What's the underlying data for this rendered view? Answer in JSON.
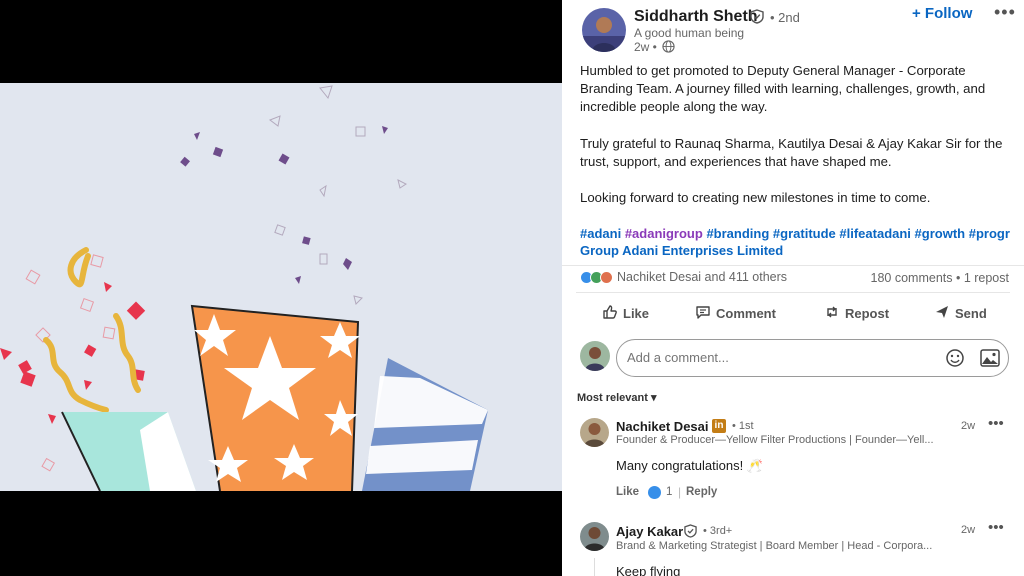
{
  "post": {
    "author": {
      "name": "Siddharth Sheth",
      "degree": "• 2nd",
      "headline": "A good human being",
      "time": "2w •"
    },
    "follow_label": "+ Follow",
    "more_label": "•••",
    "body_paragraphs": [
      "Humbled to get promoted to Deputy General Manager - Corporate Branding Team. A journey filled with learning, challenges, growth, and incredible people along the way.",
      "Truly grateful to Raunaq Sharma, Kautilya Desai & Ajay Kakar Sir for the trust, support, and experiences that have shaped me.",
      "Looking forward to creating new milestones in time to come."
    ],
    "hashtags": {
      "h1": "#adani",
      "h2": "#adanigroup",
      "h3": "#branding",
      "h4": "#gratitude",
      "h5": "#lifeatadani",
      "h6": "#growth",
      "h7": "#progr"
    },
    "group_link": "Group Adani Enterprises Limited",
    "reactions_text": "Nachiket Desai and 411 others",
    "counts_text": "180 comments • 1 repost",
    "actions": {
      "like": "Like",
      "comment": "Comment",
      "repost": "Repost",
      "send": "Send"
    },
    "comment_placeholder": "Add a comment...",
    "sort_label": "Most relevant ▾"
  },
  "comments": [
    {
      "name": "Nachiket Desai",
      "badge": "in",
      "degree": "• 1st",
      "headline": "Founder & Producer—Yellow Filter Productions | Founder—Yell...",
      "time": "2w",
      "more": "•••",
      "text": "Many congratulations! 🥂",
      "like_label": "Like",
      "like_count": "1",
      "separator": "|",
      "reply_label": "Reply"
    },
    {
      "name": "Ajay Kakar",
      "degree": "• 3rd+",
      "headline": "Brand & Marketing Strategist | Board Member | Head - Corpora...",
      "time": "2w",
      "more": "•••",
      "text": "Keep flying"
    }
  ],
  "colors": {
    "accent": "#0a66c2",
    "hashtag_purple": "#8a3ab9",
    "media_bg": "#e1e6ef",
    "orange_box": "#f6954b",
    "teal_box": "#a8e6dc",
    "blue_box": "#7391c9",
    "confetti_red": "#e7354d",
    "confetti_purple": "#6e4d8b",
    "ribbon_gold": "#e7b53c"
  },
  "icons": {
    "verified": "verified-shield-icon",
    "globe": "globe-icon",
    "like": "thumbs-up-icon",
    "comment": "speech-bubble-icon",
    "repost": "repost-arrows-icon",
    "send": "send-plane-icon",
    "emoji": "emoji-icon",
    "image": "image-icon"
  }
}
